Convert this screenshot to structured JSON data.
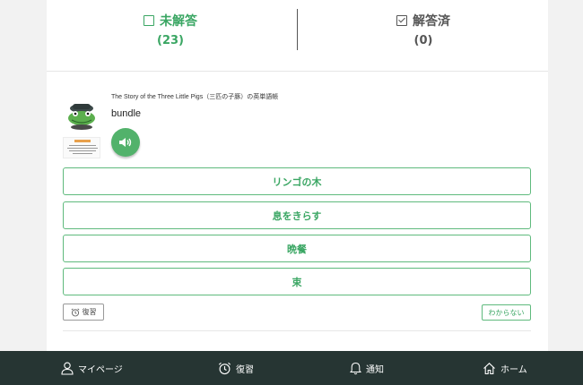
{
  "tabs": {
    "unanswered": {
      "label": "未解答",
      "count": "(23)",
      "icon": "checkbox-empty-icon"
    },
    "answered": {
      "label": "解答済",
      "count": "(0)",
      "icon": "checkbox-checked-icon"
    }
  },
  "question": {
    "source": "The Story of the Three Little Pigs（三匹の子豚）の英単語帳",
    "word": "bundle",
    "audio_icon": "speaker-icon",
    "mascot_icon": "frog-mascot-icon",
    "thumbnail_icon": "book-thumbnail-icon"
  },
  "choices": [
    "リンゴの木",
    "息をきらす",
    "晩餐",
    "束"
  ],
  "actions": {
    "review_label": "復習",
    "review_icon": "alarm-clock-icon",
    "dont_know_label": "わからない"
  },
  "nav": [
    {
      "label": "マイページ",
      "icon": "person-icon"
    },
    {
      "label": "復習",
      "icon": "alarm-clock-icon"
    },
    {
      "label": "通知",
      "icon": "bell-icon"
    },
    {
      "label": "ホーム",
      "icon": "home-icon"
    }
  ],
  "colors": {
    "accent": "#3aa663",
    "navbar": "#263533",
    "audio_button": "#52b26b"
  }
}
